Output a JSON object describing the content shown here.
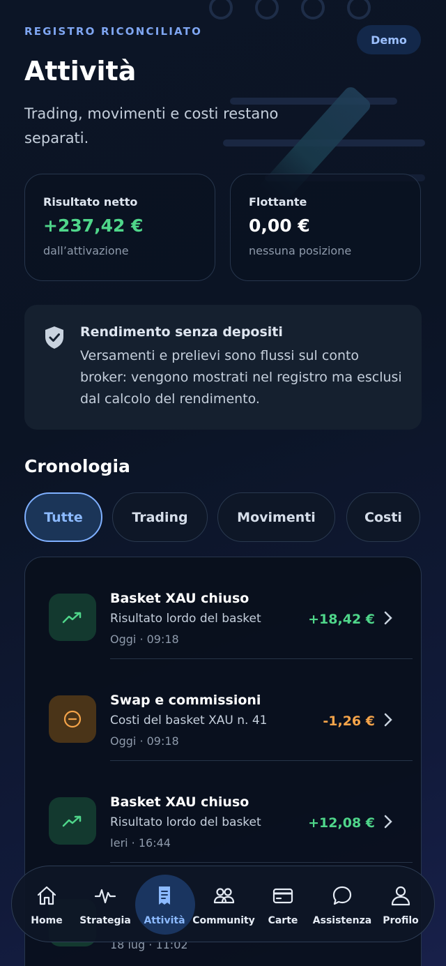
{
  "header": {
    "eyebrow": "REGISTRO RICONCILIATO",
    "mode_badge": "Demo",
    "title": "Attività",
    "subtitle": "Trading, movimenti e costi restano separati."
  },
  "stats": [
    {
      "label": "Risultato netto",
      "value": "+237,42 €",
      "note": "dall’attivazione",
      "tone": "positive"
    },
    {
      "label": "Flottante",
      "value": "0,00 €",
      "note": "nessuna posizione",
      "tone": "neutral"
    }
  ],
  "info": {
    "icon": "shield-check-icon",
    "title": "Rendimento senza depositi",
    "body": "Versamenti e prelievi sono flussi sul conto broker: vengono mostrati nel registro ma esclusi dal calcolo del rendimento."
  },
  "history": {
    "title": "Cronologia",
    "filters": [
      {
        "label": "Tutte",
        "active": true
      },
      {
        "label": "Trading",
        "active": false
      },
      {
        "label": "Movimenti",
        "active": false
      },
      {
        "label": "Costi",
        "active": false
      }
    ],
    "rows": [
      {
        "icon": "trend-up-icon",
        "title": "Basket XAU chiuso",
        "subtitle": "Risultato lordo del basket",
        "time": "Oggi · 09:18",
        "amount": "+18,42 €",
        "tone": "positive"
      },
      {
        "icon": "minus-circle-icon",
        "title": "Swap e commissioni",
        "subtitle": "Costi del basket XAU n. 41",
        "time": "Oggi · 09:18",
        "amount": "-1,26 €",
        "tone": "negative"
      },
      {
        "icon": "trend-up-icon",
        "title": "Basket XAU chiuso",
        "subtitle": "Risultato lordo del basket",
        "time": "Ieri · 16:44",
        "amount": "+12,08 €",
        "tone": "positive"
      },
      {
        "icon": "arrow-icon",
        "title": "",
        "subtitle": "",
        "time": "18 lug · 11:02",
        "amount": "",
        "tone": "positive"
      }
    ]
  },
  "nav": [
    {
      "label": "Home",
      "icon": "home-icon",
      "active": false
    },
    {
      "label": "Strategia",
      "icon": "pulse-icon",
      "active": false
    },
    {
      "label": "Attività",
      "icon": "receipt-icon",
      "active": true
    },
    {
      "label": "Community",
      "icon": "users-icon",
      "active": false
    },
    {
      "label": "Carte",
      "icon": "card-icon",
      "active": false
    },
    {
      "label": "Assistenza",
      "icon": "chat-icon",
      "active": false
    },
    {
      "label": "Profilo",
      "icon": "user-icon",
      "active": false
    }
  ],
  "colors": {
    "positive": "#4fd68a",
    "negative": "#f5a44a",
    "accent": "#7fb0ff"
  }
}
